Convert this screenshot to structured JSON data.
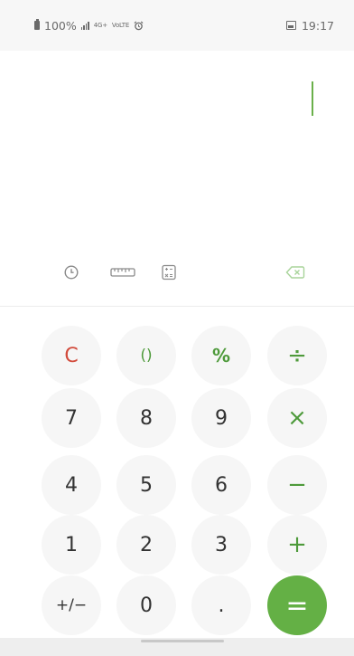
{
  "status_bar": {
    "battery_text": "100%",
    "network_badge_1": "4G+",
    "network_badge_2": "VoLTE",
    "time": "19:17"
  },
  "display": {
    "expression": "",
    "accent_color": "#6ab04a"
  },
  "tools": {
    "history_icon": "history-icon",
    "converter_icon": "ruler-icon",
    "scientific_icon": "scientific-calculator-icon",
    "backspace_icon": "backspace-icon"
  },
  "keypad": {
    "row1": [
      "C",
      "()",
      "%",
      "÷"
    ],
    "row2": [
      "7",
      "8",
      "9",
      "×"
    ],
    "row3": [
      "4",
      "5",
      "6",
      "−"
    ],
    "row4": [
      "1",
      "2",
      "3",
      "+"
    ],
    "row5": [
      "+/−",
      "0",
      ".",
      "="
    ]
  },
  "colors": {
    "clear": "#d24b3c",
    "operator": "#4e9a3b",
    "equals_bg": "#64b045",
    "key_bg": "#f6f6f6"
  }
}
